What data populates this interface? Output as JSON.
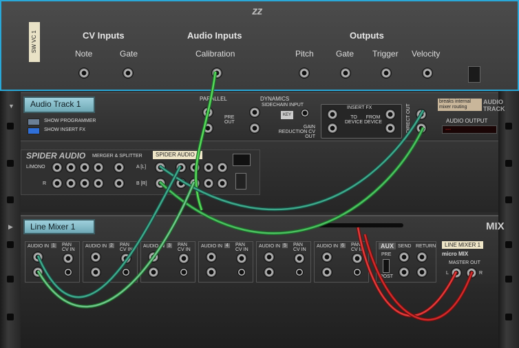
{
  "cv_device": {
    "tape_label": "SW VC 1",
    "groups": {
      "cv_inputs": "CV Inputs",
      "audio_inputs": "Audio Inputs",
      "outputs": "Outputs"
    },
    "jacks": {
      "note": "Note",
      "gate_in": "Gate",
      "calibration": "Calibration",
      "pitch": "Pitch",
      "gate_out": "Gate",
      "trigger": "Trigger",
      "velocity": "Velocity"
    }
  },
  "audio_track": {
    "name": "Audio Track 1",
    "show_programmer": "SHOW PROGRAMMER",
    "show_insert_fx": "SHOW INSERT FX",
    "parallel": "PARALLEL",
    "pre_out": "PRE OUT",
    "dynamics": "DYNAMICS",
    "sidechain_input": "SIDECHAIN INPUT",
    "key": "KEY",
    "gain_reduction_cv_out": "GAIN REDUCTION CV OUT",
    "insert_fx": "INSERT FX",
    "to_device": "TO DEVICE",
    "from_device": "FROM DEVICE",
    "direct_out": "DIRECT OUT",
    "breaks_internal": "breaks internal mixer routing",
    "audio_track_title": "AUDIO TRACK",
    "audio_output": "AUDIO OUTPUT",
    "audio_output_value": "---"
  },
  "spider": {
    "brand": "SPIDER AUDIO",
    "subtitle": "MERGER & SPLITTER",
    "name_tape": "SPIDER AUDIO 1",
    "l_mono": "L/MONO",
    "r": "R",
    "a_l": "A [L]",
    "b_r": "B [R]"
  },
  "line_mixer": {
    "name": "Line Mixer 1",
    "mix": "MIX",
    "audio_in": "AUDIO IN",
    "pan_cv_in": "PAN CV IN",
    "channels": [
      "1",
      "2",
      "3",
      "4",
      "5",
      "6"
    ],
    "aux": "AUX",
    "pre": "PRE",
    "post": "POST",
    "send": "SEND",
    "return": "RETURN",
    "name_tape": "LINE MIXER 1",
    "micromix": "micro MIX",
    "master_out": "MASTER OUT",
    "l": "L",
    "r": "R"
  }
}
